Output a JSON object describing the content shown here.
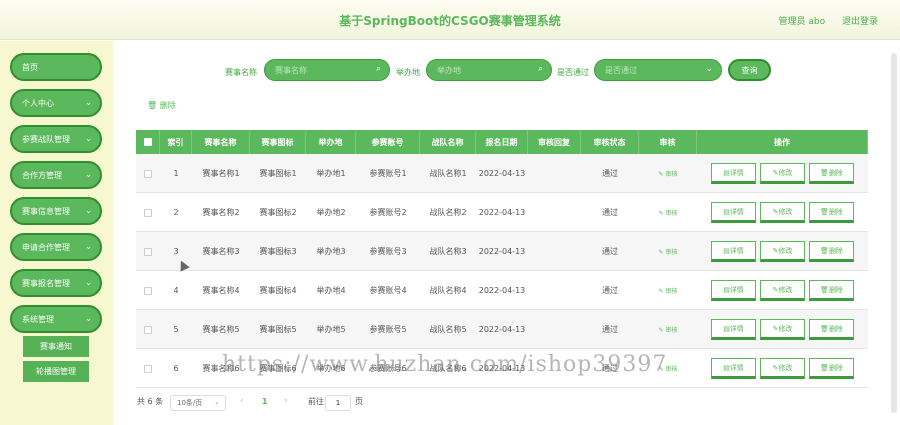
{
  "header": {
    "title": "基于SpringBoot的CSGO赛事管理系统",
    "user_label": "管理员 abo",
    "logout_label": "退出登录"
  },
  "sidebar": {
    "items": [
      {
        "label": "首页",
        "has_chevron": false
      },
      {
        "label": "个人中心",
        "has_chevron": true
      },
      {
        "label": "参赛战队管理",
        "has_chevron": true
      },
      {
        "label": "合作方管理",
        "has_chevron": true
      },
      {
        "label": "赛事信息管理",
        "has_chevron": true
      },
      {
        "label": "申请合作管理",
        "has_chevron": true
      },
      {
        "label": "赛事报名管理",
        "has_chevron": true
      },
      {
        "label": "系统管理",
        "has_chevron": true
      }
    ],
    "subitems": [
      "赛事通知",
      "轮播图管理"
    ]
  },
  "search": {
    "name_label": "赛事名称",
    "name_placeholder": "赛事名称",
    "host_label": "举办地",
    "host_placeholder": "举办地",
    "passed_label": "是否通过",
    "passed_placeholder": "是否通过",
    "query_label": "查询"
  },
  "toolbar": {
    "delete_label": "删除"
  },
  "table": {
    "columns": [
      "索引",
      "赛事名称",
      "赛事图标",
      "举办地",
      "参赛账号",
      "战队名称",
      "报名日期",
      "审核回复",
      "审核状态",
      "审核",
      "操作"
    ],
    "rows": [
      {
        "index": "1",
        "name": "赛事名称1",
        "icon": "赛事图标1",
        "host": "举办地1",
        "account": "参赛账号1",
        "team": "战队名称1",
        "date": "2022-04-13",
        "reply": "",
        "status": "通过",
        "audit": "审核"
      },
      {
        "index": "2",
        "name": "赛事名称2",
        "icon": "赛事图标2",
        "host": "举办地2",
        "account": "参赛账号2",
        "team": "战队名称2",
        "date": "2022-04-13",
        "reply": "",
        "status": "通过",
        "audit": "审核"
      },
      {
        "index": "3",
        "name": "赛事名称3",
        "icon": "赛事图标3",
        "host": "举办地3",
        "account": "参赛账号3",
        "team": "战队名称3",
        "date": "2022-04-13",
        "reply": "",
        "status": "通过",
        "audit": "审核"
      },
      {
        "index": "4",
        "name": "赛事名称4",
        "icon": "赛事图标4",
        "host": "举办地4",
        "account": "参赛账号4",
        "team": "战队名称4",
        "date": "2022-04-13",
        "reply": "",
        "status": "通过",
        "audit": "审核"
      },
      {
        "index": "5",
        "name": "赛事名称5",
        "icon": "赛事图标5",
        "host": "举办地5",
        "account": "参赛账号5",
        "team": "战队名称5",
        "date": "2022-04-13",
        "reply": "",
        "status": "通过",
        "audit": "审核"
      },
      {
        "index": "6",
        "name": "赛事名称6",
        "icon": "赛事图标6",
        "host": "举办地6",
        "account": "参赛账号6",
        "team": "战队名称6",
        "date": "2022-04-13",
        "reply": "",
        "status": "通过",
        "audit": "审核"
      }
    ],
    "op_detail": "详情",
    "op_edit": "修改",
    "op_delete": "删除"
  },
  "pager": {
    "total": "共 6 条",
    "page_size": "10条/页",
    "current_page": "1",
    "goto_label": "前往",
    "goto_value": "1",
    "page_unit": "页"
  },
  "watermark": "https://www.huzhan.com/ishop39397",
  "colors": {
    "accent": "#5cb85c",
    "accent_dark": "#2f8f2f",
    "sidebar_bg": "#f8f8d0"
  }
}
